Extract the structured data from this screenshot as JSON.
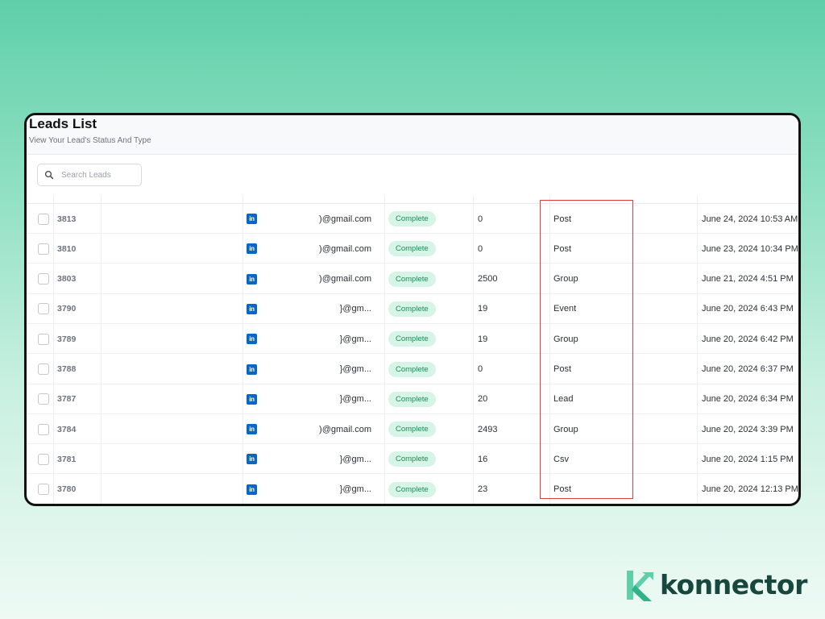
{
  "header": {
    "title": "Leads List",
    "subtitle": "View Your Lead's Status And Type"
  },
  "search": {
    "placeholder": "Search Leads",
    "value": ""
  },
  "table": {
    "rows": [
      {
        "id": "3813",
        "network_icon": "linkedin-icon",
        "email": ")@gmail.com",
        "status": "Complete",
        "count": "0",
        "type": "Post",
        "date": "June 24, 2024 10:53 AM"
      },
      {
        "id": "3810",
        "network_icon": "linkedin-icon",
        "email": ")@gmail.com",
        "status": "Complete",
        "count": "0",
        "type": "Post",
        "date": "June 23, 2024 10:34 PM"
      },
      {
        "id": "3803",
        "network_icon": "linkedin-icon",
        "email": ")@gmail.com",
        "status": "Complete",
        "count": "2500",
        "type": "Group",
        "date": "June 21, 2024 4:51 PM"
      },
      {
        "id": "3790",
        "network_icon": "linkedin-icon",
        "email": "}@gm...",
        "status": "Complete",
        "count": "19",
        "type": "Event",
        "date": "June 20, 2024 6:43 PM"
      },
      {
        "id": "3789",
        "network_icon": "linkedin-icon",
        "email": "}@gm...",
        "status": "Complete",
        "count": "19",
        "type": "Group",
        "date": "June 20, 2024 6:42 PM"
      },
      {
        "id": "3788",
        "network_icon": "linkedin-icon",
        "email": "}@gm...",
        "status": "Complete",
        "count": "0",
        "type": "Post",
        "date": "June 20, 2024 6:37 PM"
      },
      {
        "id": "3787",
        "network_icon": "linkedin-icon",
        "email": "}@gm...",
        "status": "Complete",
        "count": "20",
        "type": "Lead",
        "date": "June 20, 2024 6:34 PM"
      },
      {
        "id": "3784",
        "network_icon": "linkedin-icon",
        "email": ")@gmail.com",
        "status": "Complete",
        "count": "2493",
        "type": "Group",
        "date": "June 20, 2024 3:39 PM"
      },
      {
        "id": "3781",
        "network_icon": "linkedin-icon",
        "email": "}@gm...",
        "status": "Complete",
        "count": "16",
        "type": "Csv",
        "date": "June 20, 2024 1:15 PM"
      },
      {
        "id": "3780",
        "network_icon": "linkedin-icon",
        "email": "}@gm...",
        "status": "Complete",
        "count": "23",
        "type": "Post",
        "date": "June 20, 2024 12:13 PM"
      }
    ]
  },
  "linkedin_label": "in",
  "brand": {
    "name": "konnector"
  },
  "colors": {
    "accent": "#5fcfa9",
    "badge_bg": "#d6f5e6",
    "badge_text": "#1f8a5a",
    "highlight": "#e23b3b",
    "linkedin": "#0a66c2",
    "brand_text": "#17473d"
  }
}
